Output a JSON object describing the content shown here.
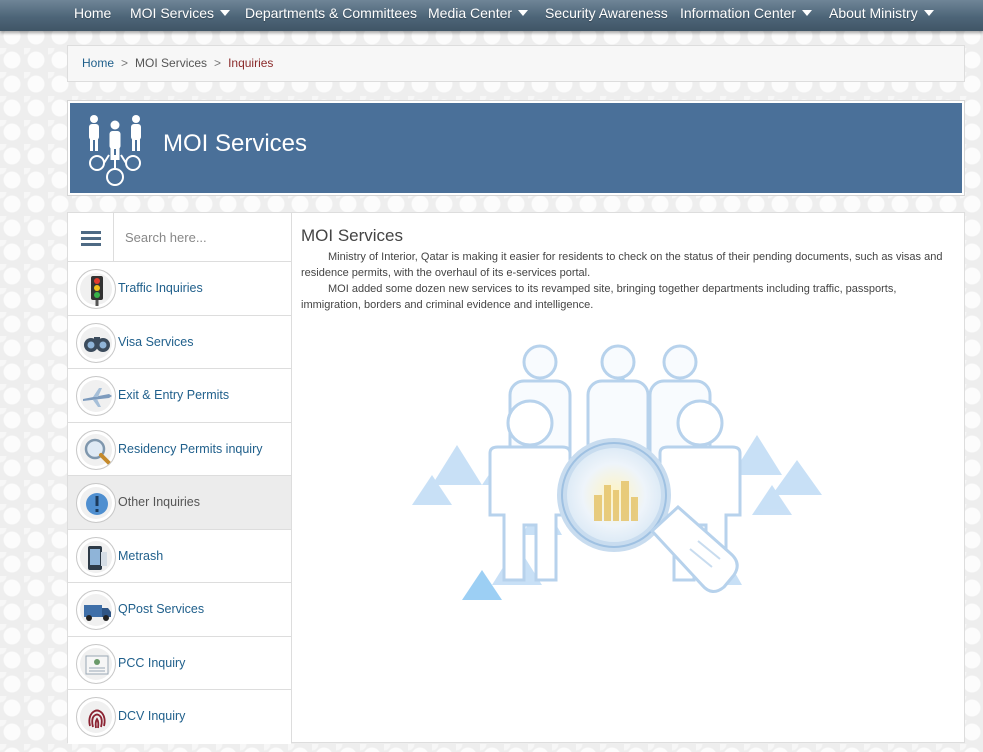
{
  "nav": {
    "items": [
      {
        "label": "Home",
        "dropdown": false
      },
      {
        "label": "MOI Services",
        "dropdown": true
      },
      {
        "label": "Departments & Committees",
        "dropdown": false
      },
      {
        "label": "Media Center",
        "dropdown": true
      },
      {
        "label": "Security Awareness",
        "dropdown": false
      },
      {
        "label": "Information Center",
        "dropdown": true
      },
      {
        "label": "About Ministry",
        "dropdown": true
      }
    ]
  },
  "breadcrumb": {
    "home": "Home",
    "section": "MOI Services",
    "current": "Inquiries",
    "separator": ">"
  },
  "banner": {
    "title": "MOI Services",
    "icon": "people-network-icon"
  },
  "sidebar": {
    "search_placeholder": "Search here...",
    "items": [
      {
        "label": "Traffic Inquiries",
        "icon": "traffic-light-icon",
        "active": false
      },
      {
        "label": "Visa Services",
        "icon": "binoculars-icon",
        "active": false
      },
      {
        "label": "Exit & Entry Permits",
        "icon": "airplane-icon",
        "active": false
      },
      {
        "label": "Residency Permits inquiry",
        "icon": "magnifier-icon",
        "active": false
      },
      {
        "label": "Other Inquiries",
        "icon": "exclamation-icon",
        "active": true
      },
      {
        "label": "Metrash",
        "icon": "phone-icon",
        "active": false
      },
      {
        "label": "QPost Services",
        "icon": "delivery-van-icon",
        "active": false
      },
      {
        "label": "PCC Inquiry",
        "icon": "certificate-icon",
        "active": false
      },
      {
        "label": "DCV Inquiry",
        "icon": "fingerprint-icon",
        "active": false
      }
    ]
  },
  "content": {
    "title": "MOI Services",
    "paragraphs": [
      "Ministry of Interior, Qatar is making it easier for residents to check on the status of their pending documents, such as visas and residence permits, with the overhaul of its e-services portal.",
      "MOI added some dozen new services to its revamped site, bringing together departments including traffic, passports, immigration, borders and criminal evidence and intelligence."
    ],
    "hero_icon": "people-magnifier-illustration"
  },
  "colors": {
    "nav_bg": "#4d6578",
    "banner_bg": "#4a7099",
    "link": "#1f5f8b",
    "breadcrumb_current": "#8b2b2b",
    "text": "#444444"
  }
}
